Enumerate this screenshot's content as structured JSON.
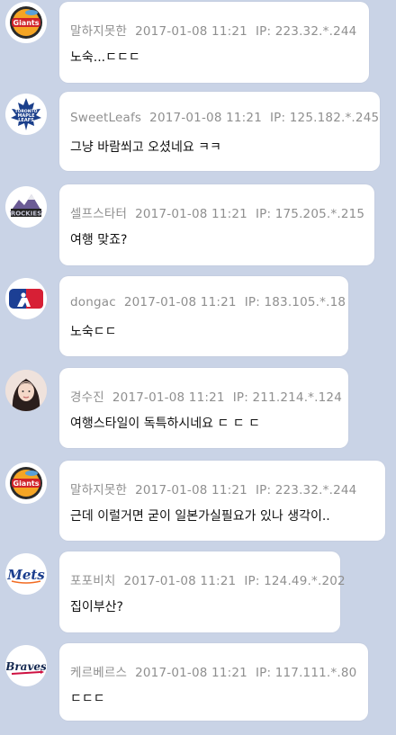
{
  "comments": [
    {
      "username": "말하지못한",
      "timestamp": "2017-01-08 11:21",
      "ip": "IP: 223.32.*.244",
      "text": "노숙...ㄷㄷㄷ",
      "avatar_icon": "giants-logo-icon"
    },
    {
      "username": "SweetLeafs",
      "timestamp": "2017-01-08 11:21",
      "ip": "IP: 125.182.*.245",
      "text": "그냥 바람쐬고 오셨네요 ㅋㅋ",
      "avatar_icon": "maple-leafs-logo-icon"
    },
    {
      "username": "셀프스타터",
      "timestamp": "2017-01-08 11:21",
      "ip": "IP: 175.205.*.215",
      "text": "여행 맞죠?",
      "avatar_icon": "rockies-logo-icon"
    },
    {
      "username": "dongac",
      "timestamp": "2017-01-08 11:21",
      "ip": "IP: 183.105.*.18",
      "text": "노숙ㄷㄷ",
      "avatar_icon": "mlb-logo-icon"
    },
    {
      "username": "경수진",
      "timestamp": "2017-01-08 11:21",
      "ip": "IP: 211.214.*.124",
      "text": "여행스타일이 독특하시네요 ㄷ ㄷ ㄷ",
      "avatar_icon": "user-photo-icon"
    },
    {
      "username": "말하지못한",
      "timestamp": "2017-01-08 11:21",
      "ip": "IP: 223.32.*.244",
      "text": "근데 이럴거면 굳이 일본가실필요가 있나 생각이..",
      "avatar_icon": "giants-logo-icon"
    },
    {
      "username": "포포비치",
      "timestamp": "2017-01-08 11:21",
      "ip": "IP: 124.49.*.202",
      "text": "집이부산?",
      "avatar_icon": "mets-logo-icon"
    },
    {
      "username": "케르베르스",
      "timestamp": "2017-01-08 11:21",
      "ip": "IP: 117.111.*.80",
      "text": "ㄷㄷㄷ",
      "avatar_icon": "braves-logo-icon"
    }
  ],
  "colors": {
    "background": "#c9d3e6",
    "bubble": "#ffffff",
    "meta": "#8f8f8f",
    "text": "#111111"
  }
}
